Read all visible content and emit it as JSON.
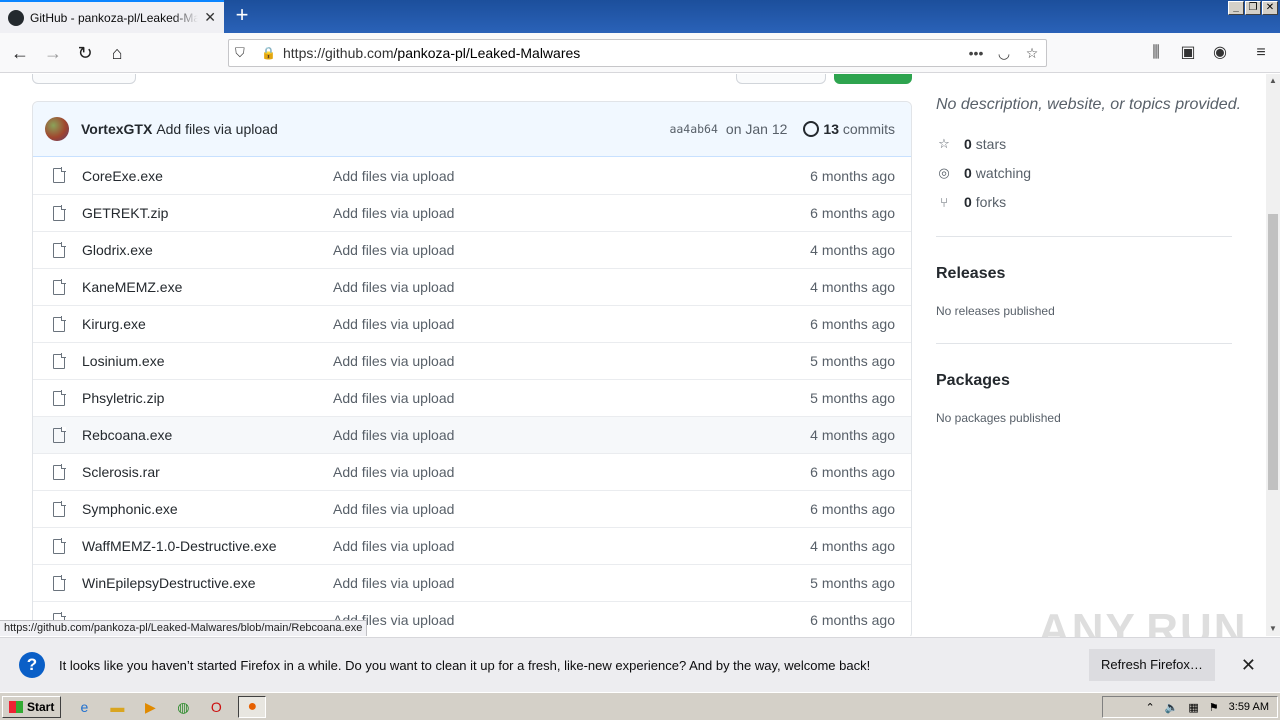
{
  "browser": {
    "tab_title": "GitHub - pankoza-pl/Leaked-Malwares",
    "url_prefix": "https://github.com",
    "url_path": "/pankoza-pl/Leaked-Malwares",
    "status_url": "https://github.com/pankoza-pl/Leaked-Malwares/blob/main/Rebcoana.exe"
  },
  "commit": {
    "author": "VortexGTX",
    "message": "Add files via upload",
    "sha": "aa4ab64",
    "date": "on Jan 12",
    "commits_count": "13",
    "commits_label": "commits"
  },
  "files": [
    {
      "name": "CoreExe.exe",
      "message": "Add files via upload",
      "age": "6 months ago"
    },
    {
      "name": "GETREKT.zip",
      "message": "Add files via upload",
      "age": "6 months ago"
    },
    {
      "name": "Glodrix.exe",
      "message": "Add files via upload",
      "age": "4 months ago"
    },
    {
      "name": "KaneMEMZ.exe",
      "message": "Add files via upload",
      "age": "4 months ago"
    },
    {
      "name": "Kirurg.exe",
      "message": "Add files via upload",
      "age": "6 months ago"
    },
    {
      "name": "Losinium.exe",
      "message": "Add files via upload",
      "age": "5 months ago"
    },
    {
      "name": "Phsyletric.zip",
      "message": "Add files via upload",
      "age": "5 months ago"
    },
    {
      "name": "Rebcoana.exe",
      "message": "Add files via upload",
      "age": "4 months ago"
    },
    {
      "name": "Sclerosis.rar",
      "message": "Add files via upload",
      "age": "6 months ago"
    },
    {
      "name": "Symphonic.exe",
      "message": "Add files via upload",
      "age": "6 months ago"
    },
    {
      "name": "WaffMEMZ-1.0-Destructive.exe",
      "message": "Add files via upload",
      "age": "4 months ago"
    },
    {
      "name": "WinEpilepsyDestructive.exe",
      "message": "Add files via upload",
      "age": "5 months ago"
    },
    {
      "name": "",
      "message": "Add files via upload",
      "age": "6 months ago"
    }
  ],
  "sidebar": {
    "description": "No description, website, or topics provided.",
    "stars_count": "0",
    "stars_label": "stars",
    "watching_count": "0",
    "watching_label": "watching",
    "forks_count": "0",
    "forks_label": "forks",
    "releases_title": "Releases",
    "releases_note": "No releases published",
    "packages_title": "Packages",
    "packages_note": "No packages published"
  },
  "notification": {
    "message": "It looks like you haven’t started Firefox in a while. Do you want to clean it up for a fresh, like-new experience? And by the way, welcome back!",
    "button": "Refresh Firefox…"
  },
  "taskbar": {
    "start": "Start",
    "clock": "3:59 AM"
  },
  "watermark": "ANY.RUN",
  "colors": {
    "accent": "#0a84ff",
    "green": "#2ea44f",
    "commit_bg": "#f1f8ff"
  }
}
